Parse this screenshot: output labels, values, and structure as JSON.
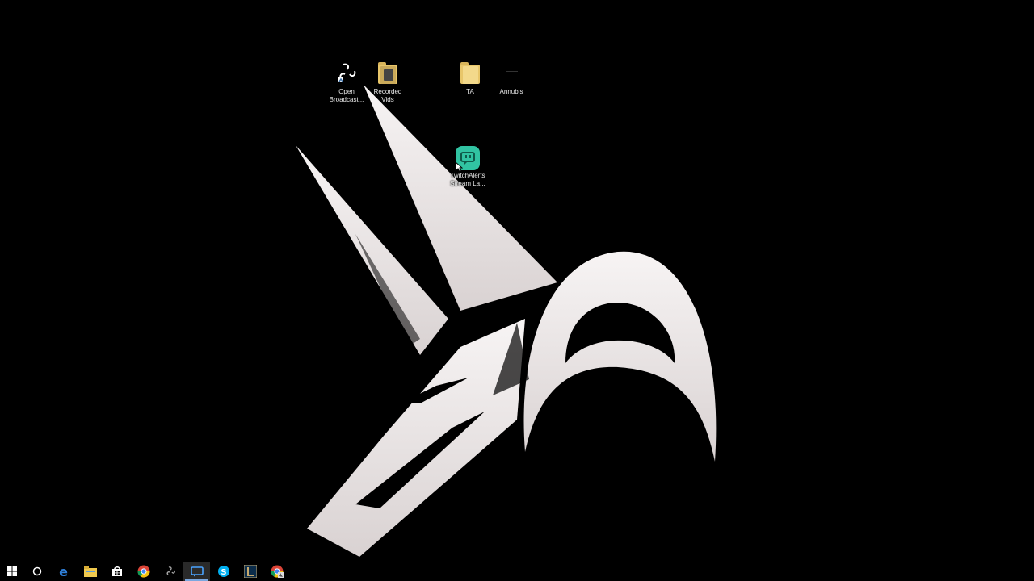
{
  "desktop": {
    "icons": [
      {
        "label": "Open\nBroadcast...",
        "icon": "obs-icon"
      },
      {
        "label": "Recorded\nVids",
        "icon": "folder-icon"
      },
      {
        "label": "TA",
        "icon": "folder-icon"
      },
      {
        "label": "Annubis",
        "icon": "blank-file-icon"
      },
      {
        "label": "TwitchAlerts\nStream La...",
        "icon": "twitchalerts-icon"
      }
    ],
    "wallpaper": "anubis-logo",
    "colors": {
      "background": "#000000",
      "logo": "#efe9e9",
      "twitchalerts": "#31c3a2"
    }
  },
  "taskbar": {
    "buttons": [
      "windows-start-icon",
      "cortana-icon",
      "edge-icon",
      "file-explorer-icon",
      "store-icon",
      "chrome-icon",
      "obs-icon",
      "streamlabs-icon",
      "skype-icon",
      "league-client-icon",
      "chrome-app-icon"
    ],
    "active": "streamlabs-icon"
  }
}
